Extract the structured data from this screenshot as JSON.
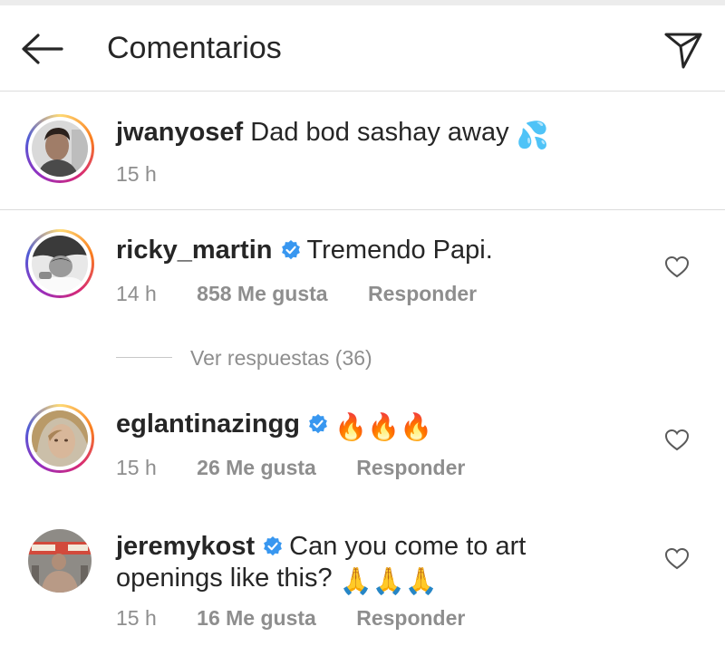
{
  "header": {
    "title": "Comentarios",
    "back_icon": "arrow-left-icon",
    "share_icon": "paper-plane-icon"
  },
  "caption": {
    "username": "jwanyosef",
    "text": "Dad bod sashay away",
    "emoji": "💦",
    "time": "15 h"
  },
  "comments": [
    {
      "username": "ricky_martin",
      "verified": true,
      "text": "Tremendo Papi.",
      "time": "14 h",
      "likes": "858 Me gusta",
      "reply": "Responder"
    },
    {
      "username": "eglantinazingg",
      "verified": true,
      "text": "🔥🔥🔥",
      "time": "15 h",
      "likes": "26 Me gusta",
      "reply": "Responder"
    },
    {
      "username": "jeremykost",
      "verified": true,
      "text": "Can you come to art",
      "text2": "openings like this?",
      "emoji2": "🙏🙏🙏",
      "time": "15 h",
      "likes": "16 Me gusta",
      "reply": "Responder"
    }
  ],
  "view_replies": "Ver respuestas (36)",
  "colors": {
    "text": "#262626",
    "secondary": "#8e8e8e",
    "verified": "#3897f0",
    "divider": "#dcdcdc"
  }
}
